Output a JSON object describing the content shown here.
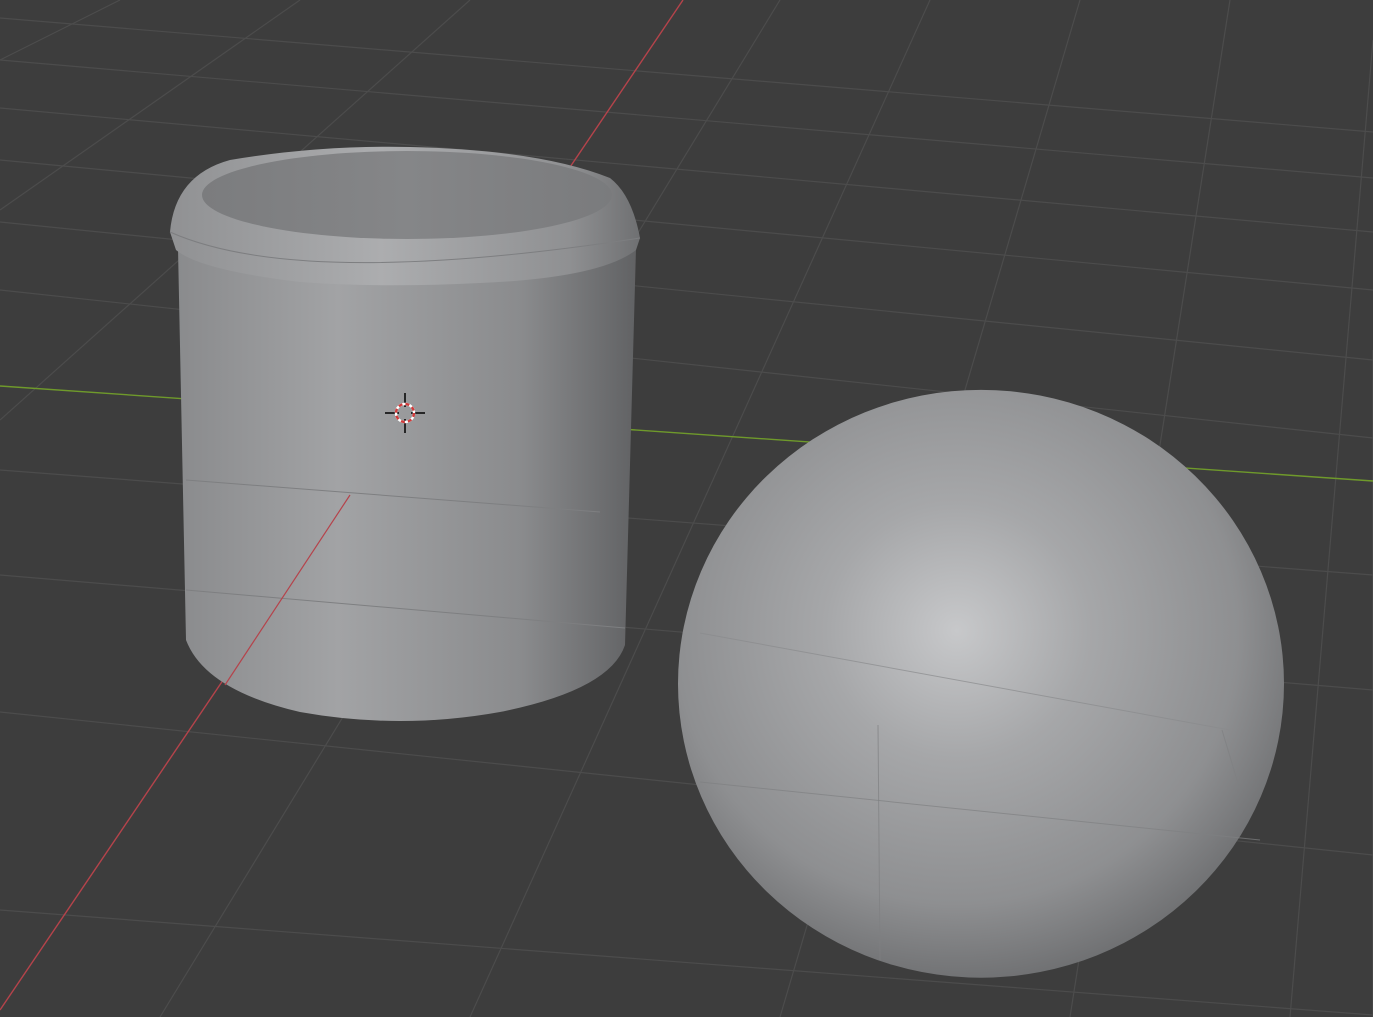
{
  "viewport": {
    "background": "#3d3d3d",
    "grid_color": "#4d4d4d",
    "x_axis_color": "#b5434b",
    "y_axis_color": "#6f9a2b"
  },
  "objects": [
    {
      "name": "Cylinder",
      "type": "cylinder",
      "shading": "solid",
      "color": "#8e9092"
    },
    {
      "name": "Sphere",
      "type": "uv-sphere",
      "shading": "solid",
      "color": "#9a9b9d"
    }
  ],
  "cursor": {
    "icon": "3d-cursor-icon",
    "ring_colors": [
      "#d23b3b",
      "#ffffff"
    ]
  }
}
